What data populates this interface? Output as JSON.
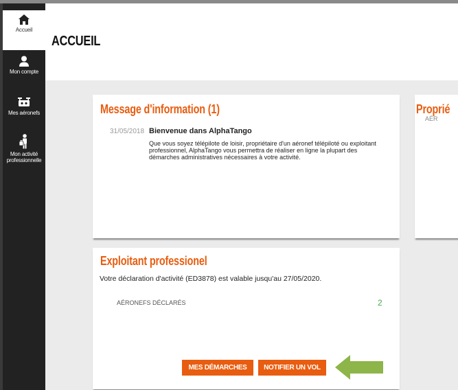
{
  "sidebar": {
    "items": [
      {
        "label": "Accueil",
        "icon": "home-icon",
        "active": true
      },
      {
        "label": "Mon compte",
        "icon": "user-icon",
        "active": false
      },
      {
        "label": "Mes aéronefs",
        "icon": "drone-icon",
        "active": false
      },
      {
        "label_lines": [
          "Mon activité",
          "professionnelle"
        ],
        "icon": "briefcase-person-icon",
        "active": false
      }
    ]
  },
  "header": {
    "title": "ACCUEIL"
  },
  "message_card": {
    "title": "Message d'information (1)",
    "date": "31/05/2018",
    "headline": "Bienvenue dans AlphaTango",
    "body": "Que vous soyez télépilote de loisir, propriétaire d'un aéronef télépiloté ou exploitant professionnel, AlphaTango vous permettra de réaliser en ligne la plupart des démarches administratives nécessaires à votre activité."
  },
  "proprietaire_card": {
    "title_partial": "Proprié",
    "label_partial": "AÉR"
  },
  "exploitant_card": {
    "title": "Exploitant professionel",
    "declaration": "Votre déclaration d'activité (ED3878) est valable jusqu'au 27/05/2020.",
    "stat_label": "AÉRONEFS DÉCLARÉS",
    "stat_value": "2",
    "buttons": {
      "demarches": "MES DÉMARCHES",
      "notifier": "NOTIFIER UN VOL"
    },
    "arrow_color": "#8db54a"
  },
  "colors": {
    "accent": "#e85d10",
    "success": "#4aa84a",
    "sidebar": "#222222"
  }
}
